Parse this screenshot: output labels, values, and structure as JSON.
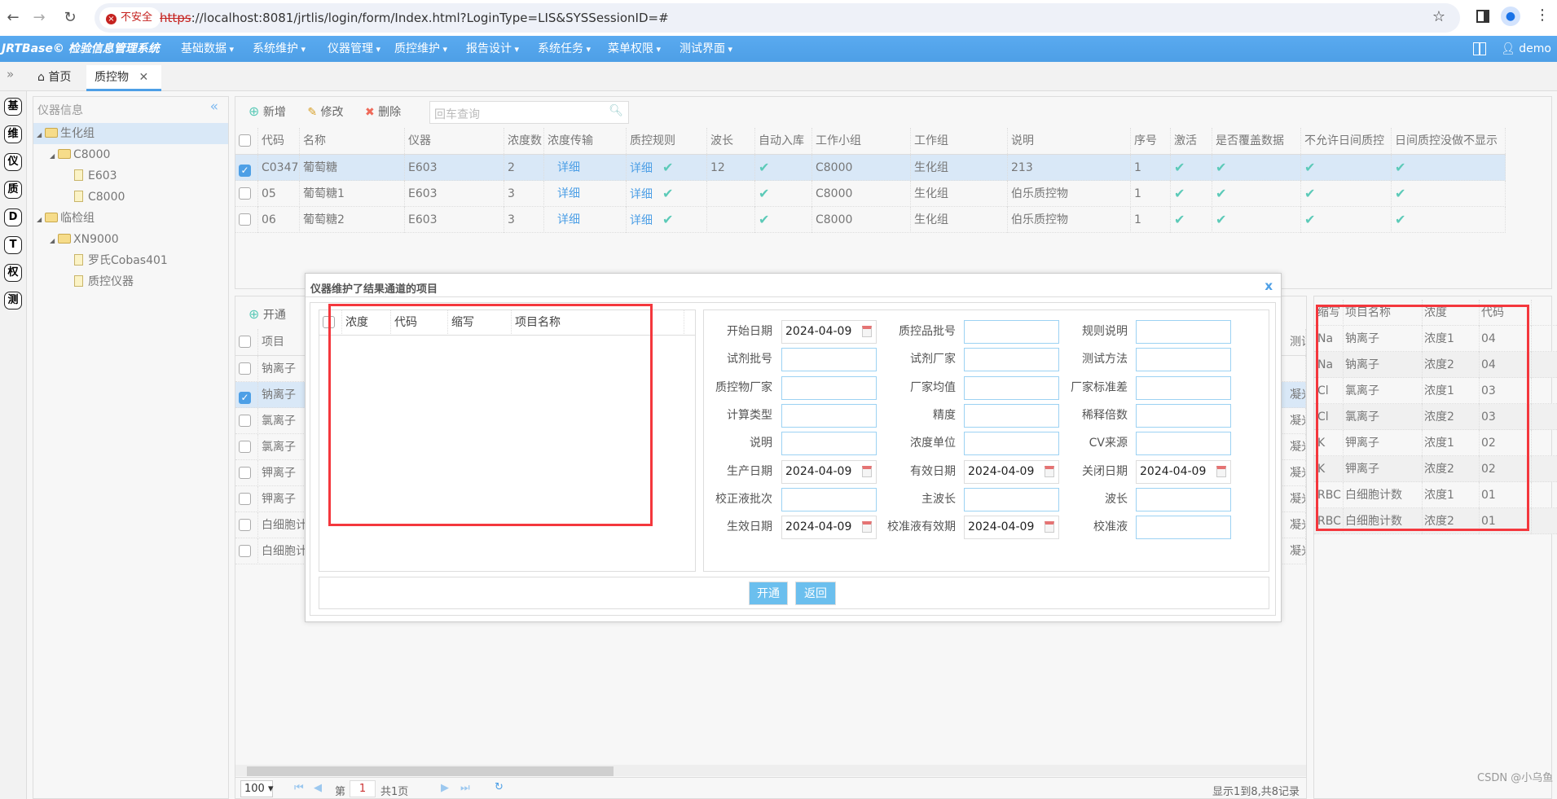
{
  "browser": {
    "insecure_label": "不安全",
    "url_scheme": "https",
    "url_rest": "://localhost:8081/jrtlis/login/form/Index.html?LoginType=LIS&SYSSessionID=#"
  },
  "app": {
    "brand": "JRTBase© 检验信息管理系统",
    "menus": [
      "基础数据",
      "系统维护",
      "仪器管理",
      "质控维护",
      "报告设计",
      "系统任务",
      "菜单权限",
      "测试界面"
    ],
    "user": "demo",
    "accent": "#4d9fe6"
  },
  "tabs": [
    {
      "label": "首页"
    },
    {
      "label": "质控物"
    }
  ],
  "rail": [
    "基",
    "维",
    "仪",
    "质",
    "D",
    "T",
    "权",
    "测"
  ],
  "tree": {
    "title": "仪器信息",
    "nodes": [
      {
        "label": "生化组",
        "level": 0,
        "type": "folder",
        "selected": true
      },
      {
        "label": "C8000",
        "level": 1,
        "type": "folder"
      },
      {
        "label": "E603",
        "level": 2,
        "type": "file"
      },
      {
        "label": "C8000",
        "level": 2,
        "type": "file"
      },
      {
        "label": "临检组",
        "level": 0,
        "type": "folder"
      },
      {
        "label": "XN9000",
        "level": 1,
        "type": "folder"
      },
      {
        "label": "罗氏Cobas401",
        "level": 2,
        "type": "file"
      },
      {
        "label": "质控仪器",
        "level": 2,
        "type": "file"
      }
    ]
  },
  "toolbar": {
    "add": "新增",
    "edit": "修改",
    "delete": "删除",
    "search_placeholder": "回车查询"
  },
  "main_table": {
    "headers": [
      "代码",
      "名称",
      "仪器",
      "浓度数",
      "浓度传输",
      "质控规则",
      "波长",
      "自动入库",
      "工作小组",
      "工作组",
      "说明",
      "序号",
      "激活",
      "是否覆盖数据",
      "不允许日间质控",
      "日间质控没做不显示"
    ],
    "rows": [
      {
        "checked": true,
        "cells": [
          "C0347",
          "葡萄糖",
          "E603",
          "2",
          "详细",
          "详细",
          "12",
          "✔",
          "C8000",
          "生化组",
          "213",
          "1",
          "✔",
          "✔",
          "✔",
          "✔"
        ]
      },
      {
        "checked": false,
        "cells": [
          "05",
          "葡萄糖1",
          "E603",
          "3",
          "详细",
          "详细",
          "",
          "✔",
          "C8000",
          "生化组",
          "伯乐质控物",
          "1",
          "✔",
          "✔",
          "✔",
          "✔"
        ]
      },
      {
        "checked": false,
        "cells": [
          "06",
          "葡萄糖2",
          "E603",
          "3",
          "详细",
          "详细",
          "",
          "✔",
          "C8000",
          "生化组",
          "伯乐质控物",
          "1",
          "✔",
          "✔",
          "✔",
          "✔"
        ]
      }
    ]
  },
  "items_panel": {
    "open_label": "开通",
    "header": "项目",
    "side_header": "测试",
    "rows": [
      {
        "checked": false,
        "name": "钠离子",
        "side": ""
      },
      {
        "checked": true,
        "name": "钠离子",
        "side": "凝光"
      },
      {
        "checked": false,
        "name": "氯离子",
        "side": "凝光"
      },
      {
        "checked": false,
        "name": "氯离子",
        "side": "凝光"
      },
      {
        "checked": false,
        "name": "钾离子",
        "side": "凝光"
      },
      {
        "checked": false,
        "name": "钾离子",
        "side": "凝光"
      },
      {
        "checked": false,
        "name": "白细胞计",
        "side": "凝光"
      },
      {
        "checked": false,
        "name": "白细胞计",
        "side": "凝光"
      }
    ]
  },
  "pager": {
    "page_size": "100",
    "page_prefix": "第",
    "page": "1",
    "page_suffix": "共1页",
    "summary": "显示1到8,共8记录"
  },
  "right_table": {
    "headers": [
      "缩写",
      "项目名称",
      "浓度",
      "代码"
    ],
    "rows": [
      [
        "Na",
        "钠离子",
        "浓度1",
        "04"
      ],
      [
        "Na",
        "钠离子",
        "浓度2",
        "04"
      ],
      [
        "Cl",
        "氯离子",
        "浓度1",
        "03"
      ],
      [
        "Cl",
        "氯离子",
        "浓度2",
        "03"
      ],
      [
        "K",
        "钾离子",
        "浓度1",
        "02"
      ],
      [
        "K",
        "钾离子",
        "浓度2",
        "02"
      ],
      [
        "RBC",
        "白细胞计数",
        "浓度1",
        "01"
      ],
      [
        "RBC",
        "白细胞计数",
        "浓度2",
        "01"
      ]
    ]
  },
  "dialog": {
    "title": "仪器维护了结果通道的项目",
    "close": "x",
    "grid_headers": [
      "浓度",
      "代码",
      "缩写",
      "项目名称"
    ],
    "fields": [
      [
        {
          "label": "开始日期",
          "value": "2024-04-09",
          "date": true
        },
        {
          "label": "质控品批号",
          "value": ""
        },
        {
          "label": "规则说明",
          "value": ""
        }
      ],
      [
        {
          "label": "试剂批号",
          "value": ""
        },
        {
          "label": "试剂厂家",
          "value": ""
        },
        {
          "label": "测试方法",
          "value": ""
        }
      ],
      [
        {
          "label": "质控物厂家",
          "value": ""
        },
        {
          "label": "厂家均值",
          "value": ""
        },
        {
          "label": "厂家标准差",
          "value": ""
        }
      ],
      [
        {
          "label": "计算类型",
          "value": ""
        },
        {
          "label": "精度",
          "value": ""
        },
        {
          "label": "稀释倍数",
          "value": ""
        }
      ],
      [
        {
          "label": "说明",
          "value": ""
        },
        {
          "label": "浓度单位",
          "value": ""
        },
        {
          "label": "CV来源",
          "value": ""
        }
      ],
      [
        {
          "label": "生产日期",
          "value": "2024-04-09",
          "date": true
        },
        {
          "label": "有效日期",
          "value": "2024-04-09",
          "date": true
        },
        {
          "label": "关闭日期",
          "value": "2024-04-09",
          "date": true
        }
      ],
      [
        {
          "label": "校正液批次",
          "value": ""
        },
        {
          "label": "主波长",
          "value": ""
        },
        {
          "label": "波长",
          "value": ""
        }
      ],
      [
        {
          "label": "生效日期",
          "value": "2024-04-09",
          "date": true
        },
        {
          "label": "校准液有效期",
          "value": "2024-04-09",
          "date": true
        },
        {
          "label": "校准液",
          "value": ""
        }
      ]
    ],
    "open_button": "开通",
    "back_button": "返回"
  },
  "watermark": "CSDN @小乌鱼"
}
